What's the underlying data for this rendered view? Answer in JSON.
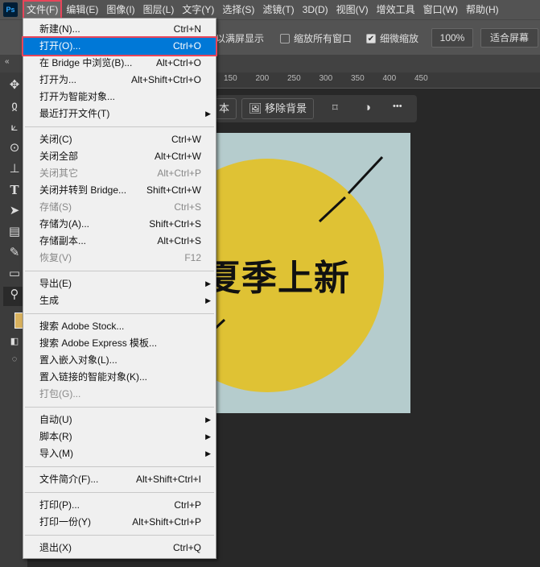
{
  "app": {
    "logo": "Ps"
  },
  "menubar": [
    "文件(F)",
    "编辑(E)",
    "图像(I)",
    "图层(L)",
    "文字(Y)",
    "选择(S)",
    "滤镜(T)",
    "3D(D)",
    "视图(V)",
    "增效工具",
    "窗口(W)",
    "帮助(H)"
  ],
  "options": {
    "fullscreen_label": "以满屏显示",
    "zoom_all_label": "缩放所有窗口",
    "zoom_all_checked": false,
    "scrubby_label": "细微缩放",
    "scrubby_checked": true,
    "zoom_value": "100%",
    "fit_screen": "适合屏幕"
  },
  "ruler": [
    "150",
    "200",
    "250",
    "300",
    "350",
    "400",
    "450"
  ],
  "contextbar": {
    "partial_label": "本",
    "remove_bg": "移除背景",
    "more": "•••"
  },
  "canvas": {
    "headline": "夏季上新",
    "bg_color": "#b5cccd",
    "circle_color": "#dfc234"
  },
  "file_menu": [
    {
      "label": "新建(N)...",
      "shortcut": "Ctrl+N"
    },
    {
      "label": "打开(O)...",
      "shortcut": "Ctrl+O",
      "highlighted": true
    },
    {
      "label": "在 Bridge 中浏览(B)...",
      "shortcut": "Alt+Ctrl+O"
    },
    {
      "label": "打开为...",
      "shortcut": "Alt+Shift+Ctrl+O"
    },
    {
      "label": "打开为智能对象...",
      "shortcut": ""
    },
    {
      "label": "最近打开文件(T)",
      "shortcut": "",
      "submenu": true
    },
    {
      "sep": true
    },
    {
      "label": "关闭(C)",
      "shortcut": "Ctrl+W"
    },
    {
      "label": "关闭全部",
      "shortcut": "Alt+Ctrl+W"
    },
    {
      "label": "关闭其它",
      "shortcut": "Alt+Ctrl+P",
      "disabled": true
    },
    {
      "label": "关闭并转到 Bridge...",
      "shortcut": "Shift+Ctrl+W"
    },
    {
      "label": "存储(S)",
      "shortcut": "Ctrl+S",
      "disabled": true
    },
    {
      "label": "存储为(A)...",
      "shortcut": "Shift+Ctrl+S"
    },
    {
      "label": "存储副本...",
      "shortcut": "Alt+Ctrl+S"
    },
    {
      "label": "恢复(V)",
      "shortcut": "F12",
      "disabled": true
    },
    {
      "sep": true
    },
    {
      "label": "导出(E)",
      "shortcut": "",
      "submenu": true
    },
    {
      "label": "生成",
      "shortcut": "",
      "submenu": true
    },
    {
      "sep": true
    },
    {
      "label": "搜索 Adobe Stock...",
      "shortcut": ""
    },
    {
      "label": "搜索 Adobe Express 模板...",
      "shortcut": ""
    },
    {
      "label": "置入嵌入对象(L)...",
      "shortcut": ""
    },
    {
      "label": "置入链接的智能对象(K)...",
      "shortcut": ""
    },
    {
      "label": "打包(G)...",
      "shortcut": "",
      "disabled": true
    },
    {
      "sep": true
    },
    {
      "label": "自动(U)",
      "shortcut": "",
      "submenu": true
    },
    {
      "label": "脚本(R)",
      "shortcut": "",
      "submenu": true
    },
    {
      "label": "导入(M)",
      "shortcut": "",
      "submenu": true
    },
    {
      "sep": true
    },
    {
      "label": "文件简介(F)...",
      "shortcut": "Alt+Shift+Ctrl+I"
    },
    {
      "sep": true
    },
    {
      "label": "打印(P)...",
      "shortcut": "Ctrl+P"
    },
    {
      "label": "打印一份(Y)",
      "shortcut": "Alt+Shift+Ctrl+P"
    },
    {
      "sep": true
    },
    {
      "label": "退出(X)",
      "shortcut": "Ctrl+Q"
    }
  ]
}
